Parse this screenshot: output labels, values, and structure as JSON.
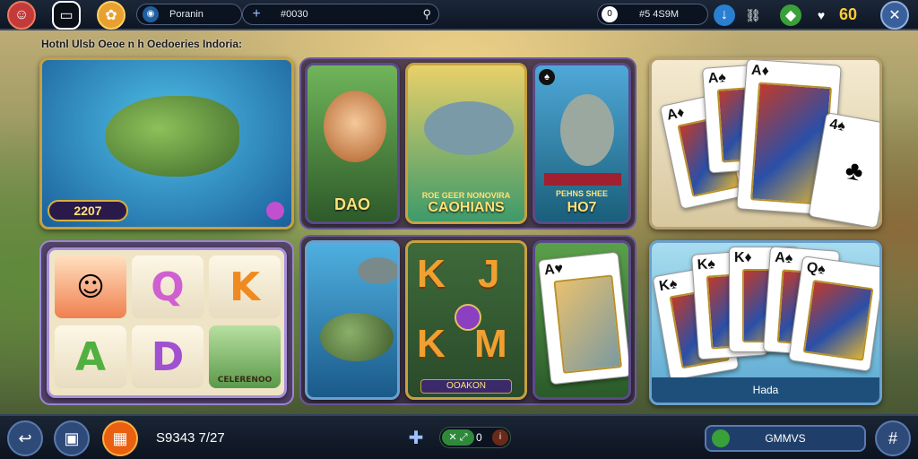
{
  "topbar": {
    "search_value": "Poranin",
    "add_value": "#0030",
    "balance": "#5 4S9M",
    "coins": "60"
  },
  "subtitle": "Hotnl Ulsb Oeoe n h Oedoeries Indoria:",
  "tiles": {
    "fish_jackpot": "2207",
    "mermaid_label": "DAO",
    "fish_hook_caption": "ROE GEER NONOVIRA",
    "fish_hook_label": "CAOHIANS",
    "fish_jump_badge": "PEHNS SHEE",
    "fish_jump_label": "HO7",
    "slot_reel_label": "CELERENOO",
    "kjkm_label": "OOAKON",
    "card_hand_label": "Hada"
  },
  "slot_symbols": [
    "Q",
    "K",
    "A",
    "D"
  ],
  "kjkm_symbols": [
    "K",
    "J",
    "K",
    "M"
  ],
  "bottombar": {
    "balance": "S9343 7/27",
    "toggle_value": "0",
    "game_button": "GMMVS"
  },
  "colors": {
    "accent_gold": "#ffe27a",
    "panel_purple": "#5b4a8a",
    "topbar": "#1b2738"
  }
}
